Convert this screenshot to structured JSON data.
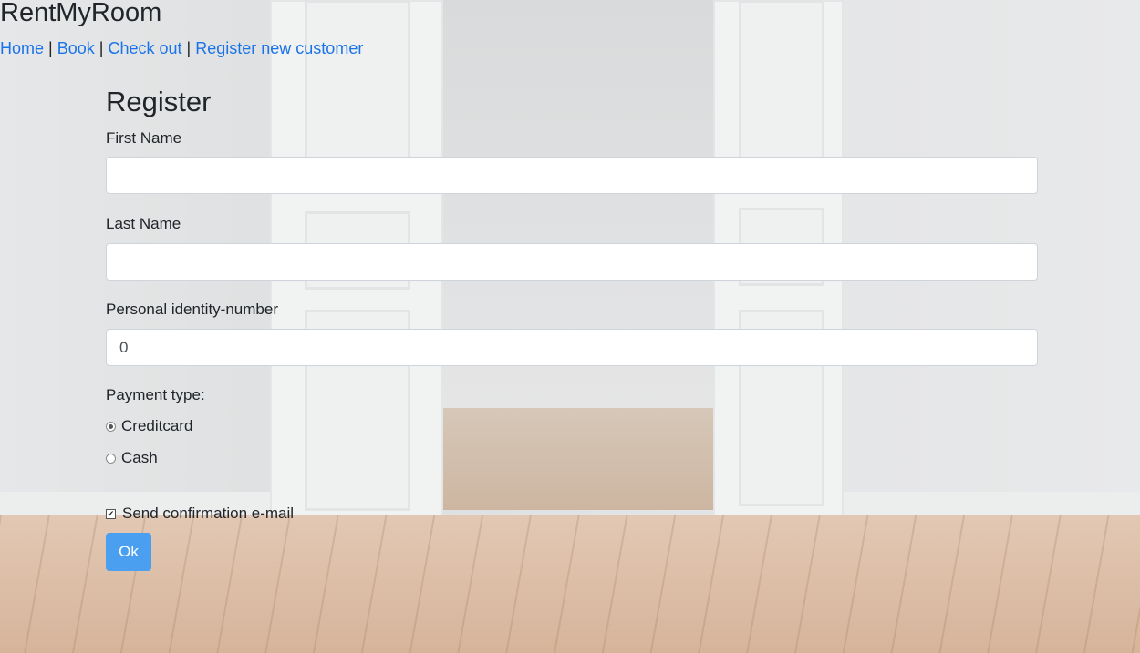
{
  "app": {
    "title": "RentMyRoom"
  },
  "nav": {
    "links": [
      "Home",
      "Book",
      "Check out",
      "Register new customer"
    ],
    "separator": "|"
  },
  "form": {
    "heading": "Register",
    "first_name": {
      "label": "First Name",
      "value": ""
    },
    "last_name": {
      "label": "Last Name",
      "value": ""
    },
    "personal_id": {
      "label": "Personal identity-number",
      "value": "0"
    },
    "payment": {
      "label": "Payment type:",
      "options": [
        "Creditcard",
        "Cash"
      ],
      "selected": "Creditcard"
    },
    "confirmation": {
      "label": "Send confirmation e-mail",
      "checked": true
    },
    "submit_label": "Ok"
  },
  "colors": {
    "link": "#1a73e8",
    "button": "#4a9ff0"
  }
}
